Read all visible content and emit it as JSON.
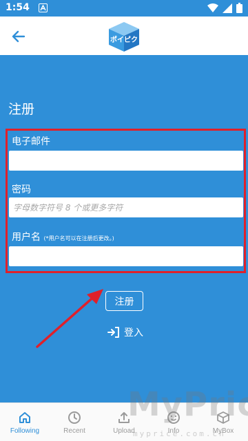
{
  "status": {
    "time": "1:54",
    "icons": [
      "notification-a-icon",
      "wifi-icon",
      "cell-signal-icon",
      "battery-icon"
    ]
  },
  "appbar": {
    "back_icon": "arrow-left-icon",
    "logo_text": "ポイピク"
  },
  "page": {
    "title": "注册"
  },
  "form": {
    "email_label": "电子邮件",
    "email_value": "",
    "password_label": "密码",
    "password_placeholder": "字母数字符号 8 个或更多字符",
    "username_label": "用户名",
    "username_hint": "(*用户名可以在注册后更改。)",
    "username_value": ""
  },
  "actions": {
    "register_label": "注册",
    "login_label": "登入"
  },
  "bottom_nav": {
    "items": [
      {
        "label": "Following",
        "icon": "home-icon"
      },
      {
        "label": "Recent",
        "icon": "clock-icon"
      },
      {
        "label": "Upload",
        "icon": "upload-icon"
      },
      {
        "label": "Info",
        "icon": "smile-icon"
      },
      {
        "label": "MyBox",
        "icon": "box-icon"
      }
    ]
  },
  "watermark": {
    "text": "MyPrice",
    "sub": "myprice.com.cn"
  },
  "colors": {
    "primary": "#2f8fd8",
    "highlight_box": "#e0202a",
    "nav_active": "#2f8fd8",
    "nav_inactive": "#9a9a9a"
  }
}
